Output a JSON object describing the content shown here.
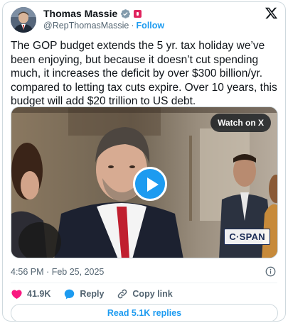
{
  "author": {
    "name": "Thomas Massie",
    "handle": "@RepThomasMassie",
    "follow_label": "Follow",
    "separator": "·",
    "verified_badge_icon": "verified-badge-icon",
    "affiliation_flag_icon": "government-flag-icon"
  },
  "tweet": {
    "text": "The GOP budget extends the 5 yr. tax holiday we’ve been enjoying, but because it doesn’t cut spending much, it increases the deficit by over $300 billion/yr. compared to letting tax cuts expire. Over 10 years, this budget will add $20 trillion to US debt.",
    "time": "4:56 PM",
    "dot": "·",
    "date": "Feb 25, 2025"
  },
  "media": {
    "watch_label": "Watch on X",
    "broadcaster_logo": "C·SPAN",
    "play_icon": "play-icon"
  },
  "actions": {
    "like_count": "41.9K",
    "reply_label": "Reply",
    "copy_link_label": "Copy link"
  },
  "footer": {
    "read_replies_label": "Read 5.1K replies"
  },
  "colors": {
    "accent": "#1d9bf0",
    "like": "#f91880",
    "text": "#0f1419",
    "secondary_text": "#536471",
    "border": "#cfd9de"
  }
}
